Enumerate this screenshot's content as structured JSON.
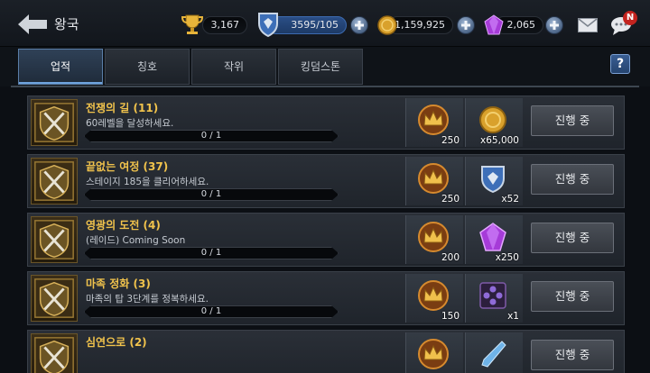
{
  "header": {
    "title": "왕국",
    "trophy_value": "3,167",
    "rank_value": "3595/105",
    "gold_value": "1,159,925",
    "gem_value": "2,065",
    "notification_badge": "N"
  },
  "tabs": [
    {
      "label": "업적",
      "active": true
    },
    {
      "label": "칭호",
      "active": false
    },
    {
      "label": "작위",
      "active": false
    },
    {
      "label": "킹덤스톤",
      "active": false
    }
  ],
  "help_label": "?",
  "achievements": [
    {
      "title": "전쟁의 길 (11)",
      "desc": "60레벨을 달성하세요.",
      "progress": "0 / 1",
      "crown": "250",
      "reward_icon": "gold-coin-icon",
      "reward_qty": "x65,000",
      "status": "진행 중"
    },
    {
      "title": "끝없는 여정 (37)",
      "desc": "스테이지 185을 클리어하세요.",
      "progress": "0 / 1",
      "crown": "250",
      "reward_icon": "rank-shield-icon",
      "reward_qty": "x52",
      "status": "진행 중"
    },
    {
      "title": "영광의 도전 (4)",
      "desc": "(레이드) Coming Soon",
      "progress": "0 / 1",
      "crown": "200",
      "reward_icon": "purple-gem-icon",
      "reward_qty": "x250",
      "status": "진행 중"
    },
    {
      "title": "마족 정화 (3)",
      "desc": "마족의 탑 3단계를 정복하세요.",
      "progress": "0 / 1",
      "crown": "150",
      "reward_icon": "rune-stone-icon",
      "reward_qty": "x1",
      "status": "진행 중"
    },
    {
      "title": "심연으로 (2)",
      "desc": "",
      "progress": "",
      "crown": "",
      "reward_icon": "crystal-icon",
      "reward_qty": "",
      "status": "진행 중"
    }
  ],
  "colors": {
    "title_gold": "#f1c34c",
    "tab_active": "#2f4157",
    "badge_red": "#c3241f"
  }
}
